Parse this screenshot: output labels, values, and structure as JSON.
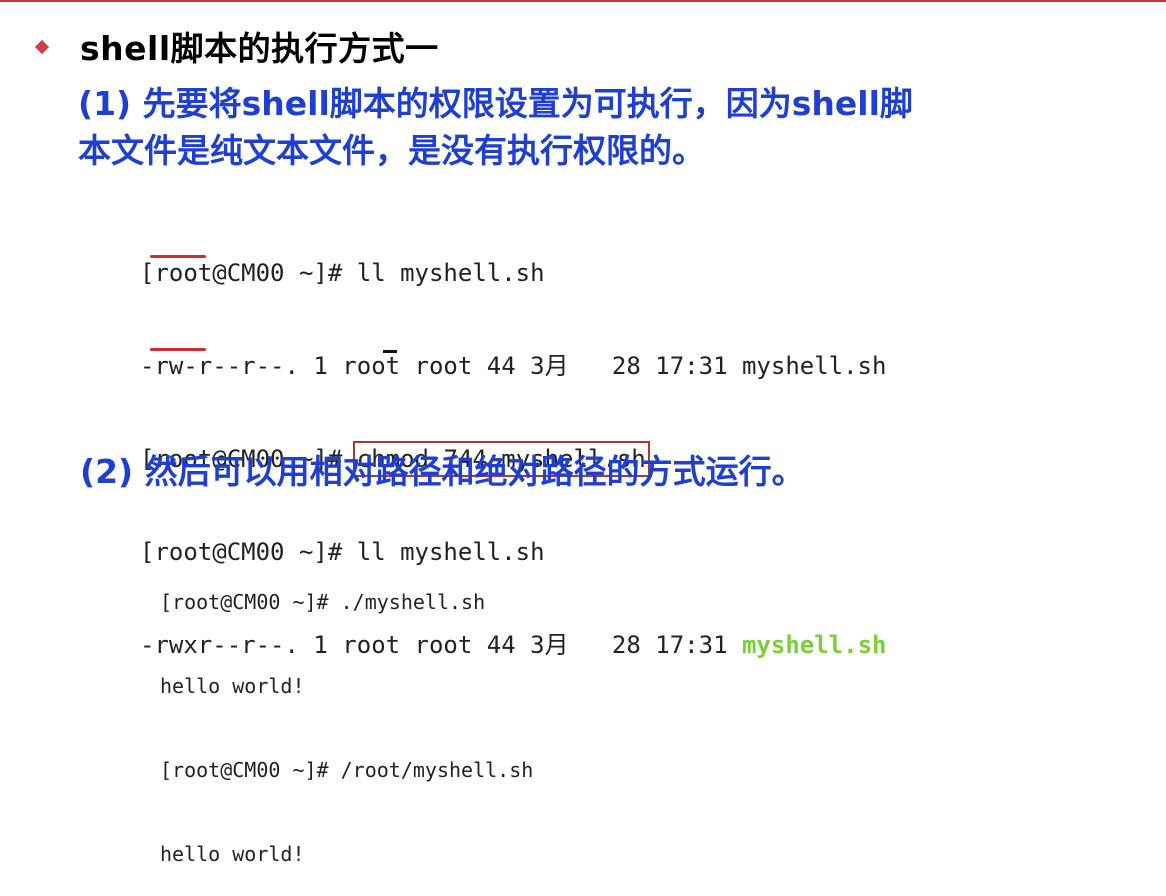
{
  "slide": {
    "title": "shell脚本的执行方式一"
  },
  "step1": {
    "line1": "(1) 先要将shell脚本的权限设置为可执行，因为shell脚",
    "line2": "本文件是纯文本文件，是没有执行权限的。"
  },
  "terminal1": {
    "lines": [
      "[root@CM00 ~]# ll myshell.sh",
      "-rw-r--r--. 1 root root 44 3月   28 17:31 myshell.sh",
      "[root@CM00 ~]# ",
      "chmod 744 myshell.sh",
      "[root@CM00 ~]# ll myshell.sh",
      "-rwxr--r--. 1 root root 44 3月   28 17:31 ",
      "myshell.sh"
    ]
  },
  "step2": {
    "text": "(2) 然后可以用相对路径和绝对路径的方式运行。"
  },
  "terminal2": {
    "lines": [
      "[root@CM00 ~]# ./myshell.sh",
      "hello world!",
      "[root@CM00 ~]# /root/myshell.sh",
      "hello world!"
    ]
  },
  "colors": {
    "accent_red": "#cc3333",
    "step_blue": "#1f3fd1",
    "exec_green": "#7ccf3a"
  }
}
